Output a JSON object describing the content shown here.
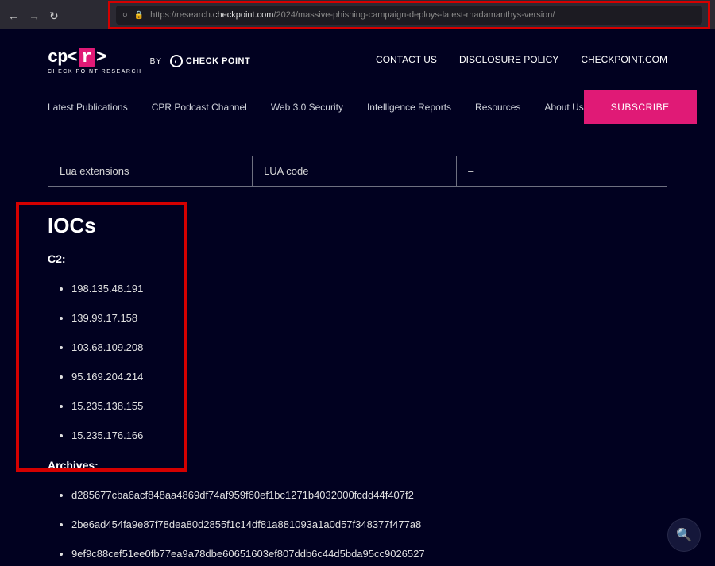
{
  "url": {
    "prefix": "https://research.",
    "host": "checkpoint.com",
    "path": "/2024/massive-phishing-campaign-deploys-latest-rhadamanthys-version/"
  },
  "logo": {
    "sub": "CHECK POINT RESEARCH",
    "by": "BY",
    "brand": "CHECK POINT"
  },
  "headerLinks": {
    "contact": "CONTACT US",
    "disclosure": "DISCLOSURE POLICY",
    "main": "CHECKPOINT.COM"
  },
  "nav": {
    "pubs": "Latest Publications",
    "pod": "CPR Podcast Channel",
    "web3": "Web 3.0 Security",
    "intel": "Intelligence Reports",
    "res": "Resources",
    "about": "About Us",
    "subscribe": "SUBSCRIBE"
  },
  "table": {
    "c1": "Lua extensions",
    "c2": "LUA code",
    "c3": "–"
  },
  "iocs": {
    "heading": "IOCs",
    "c2label": "C2:",
    "c2": {
      "0": "198.135.48.191",
      "1": "139.99.17.158",
      "2": "103.68.109.208",
      "3": "95.169.204.214",
      "4": "15.235.138.155",
      "5": "15.235.176.166"
    },
    "archLabel": "Archives:",
    "arch": {
      "0": "d285677cba6acf848aa4869df74af959f60ef1bc1271b4032000fcdd44f407f2",
      "1": "2be6ad454fa9e87f78dea80d2855f1c14df81a881093a1a0d57f348377f477a8",
      "2": "9ef9c88cef51ee0fb77ea9a78dbe60651603ef807ddb6c44d5bda95cc9026527"
    }
  }
}
